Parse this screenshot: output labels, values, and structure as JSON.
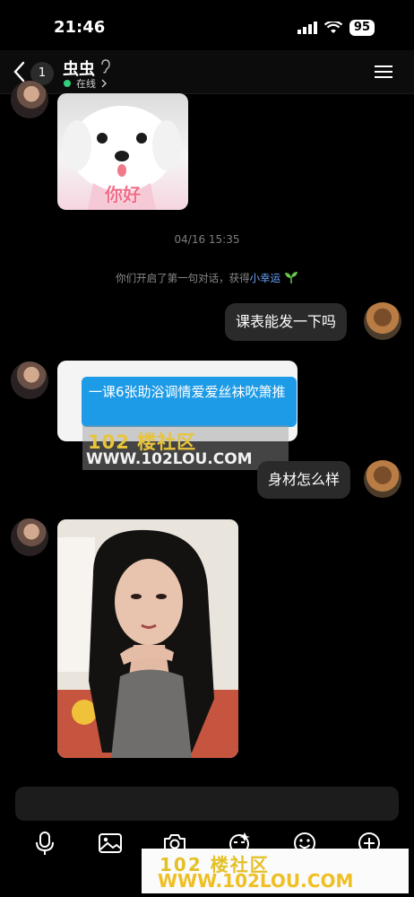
{
  "status_bar": {
    "time": "21:46",
    "battery": "95"
  },
  "header": {
    "unread_count": "1",
    "contact_name": "虫虫",
    "online_status": "在线"
  },
  "messages": {
    "timestamp": "04/16 15:35",
    "sticker_caption": "你好",
    "system_notice_prefix": "你们开启了第一句对话，获得",
    "system_notice_link": "小幸运",
    "sent_1": "课表能发一下吗",
    "received_card_text": "一课6张助浴调情爱爱丝袜吹箫推",
    "sent_2": "身材怎么样"
  },
  "watermarks": {
    "mid_line1": "102 楼社区",
    "mid_line2": "WWW.102LOU.COM",
    "bottom_line1": "102 楼社区",
    "bottom_line2": "WWW.102LOU.COM"
  },
  "toolbar": [
    "mic-icon",
    "image-icon",
    "camera-icon",
    "sticker-icon",
    "emoji-icon",
    "plus-icon"
  ],
  "colors": {
    "accent_link": "#6ea7ff",
    "online": "#31d07b",
    "card_blue": "#1e9be6"
  }
}
